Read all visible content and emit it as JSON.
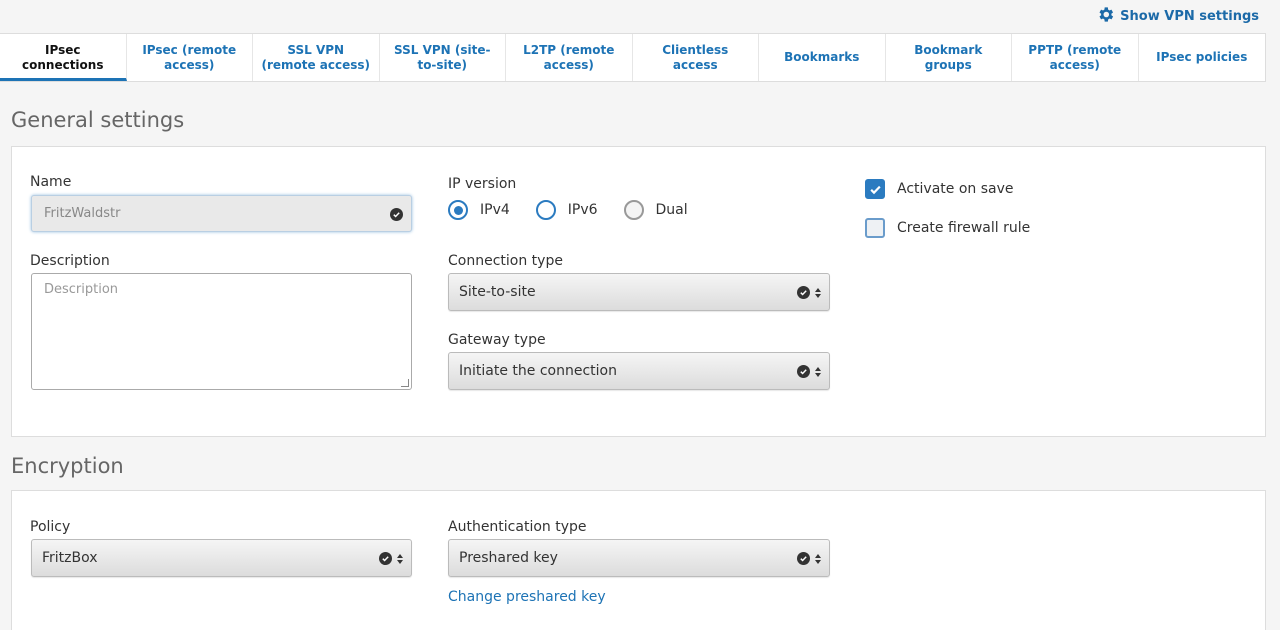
{
  "header": {
    "vpn_settings_label": "Show VPN settings"
  },
  "tabs": [
    {
      "label": "IPsec connections",
      "active": true
    },
    {
      "label": "IPsec (remote access)"
    },
    {
      "label": "SSL VPN (remote access)"
    },
    {
      "label": "SSL VPN (site-to-site)"
    },
    {
      "label": "L2TP (remote access)"
    },
    {
      "label": "Clientless access"
    },
    {
      "label": "Bookmarks"
    },
    {
      "label": "Bookmark groups"
    },
    {
      "label": "PPTP (remote access)"
    },
    {
      "label": "IPsec policies"
    }
  ],
  "general": {
    "title": "General settings",
    "name_label": "Name",
    "name_value": "FritzWaldstr",
    "description_label": "Description",
    "description_placeholder": "Description",
    "ip_version_label": "IP version",
    "ip_options": [
      "IPv4",
      "IPv6",
      "Dual"
    ],
    "ip_selected": "IPv4",
    "connection_type_label": "Connection type",
    "connection_type_value": "Site-to-site",
    "gateway_type_label": "Gateway type",
    "gateway_type_value": "Initiate the connection",
    "activate_on_save_label": "Activate on save",
    "activate_on_save_checked": true,
    "create_firewall_rule_label": "Create firewall rule",
    "create_firewall_rule_checked": false
  },
  "encryption": {
    "title": "Encryption",
    "policy_label": "Policy",
    "policy_value": "FritzBox",
    "auth_type_label": "Authentication type",
    "auth_type_value": "Preshared key",
    "change_key_link": "Change preshared key"
  },
  "colors": {
    "accent": "#1d73b5",
    "checkbox": "#2b7bc0"
  }
}
